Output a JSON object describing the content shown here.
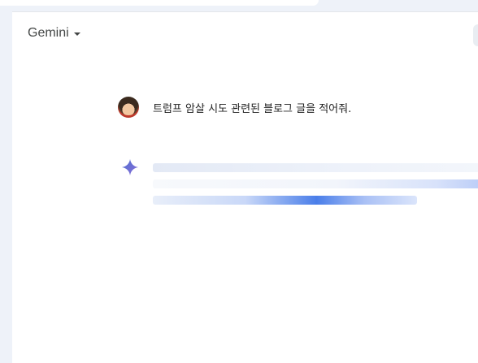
{
  "header": {
    "model_name": "Gemini"
  },
  "conversation": {
    "user_message": "트럼프 암살 시도 관련된 블로그 글을 적어줘."
  },
  "icons": {
    "model_caret": "caret-down-icon",
    "assistant_icon": "gemini-sparkle-icon",
    "avatar": "user-avatar"
  },
  "colors": {
    "accent": "#4a7ee9",
    "background": "#eef2f9",
    "surface": "#ffffff"
  }
}
